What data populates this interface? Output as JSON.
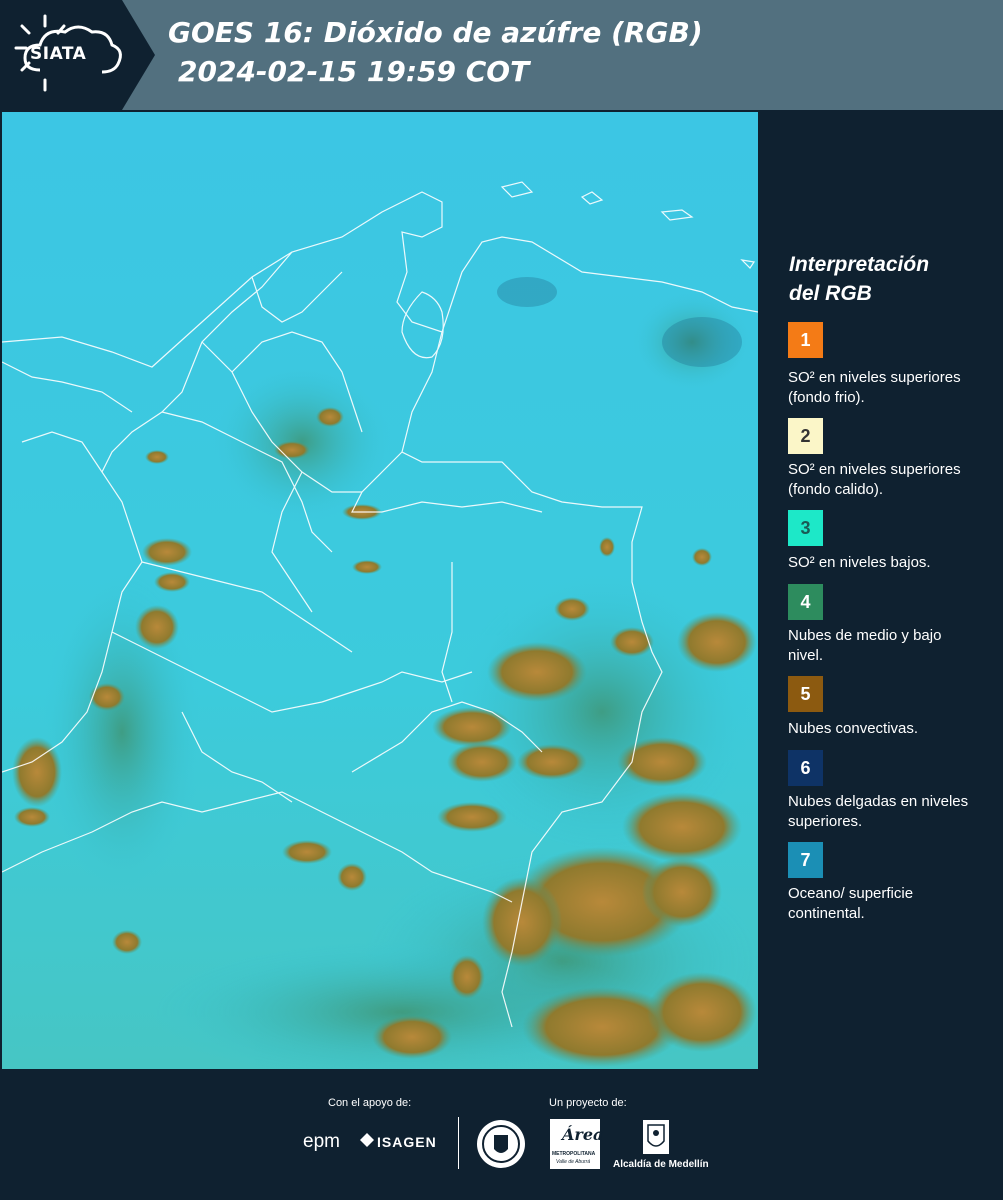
{
  "header": {
    "logo_text": "SIATA",
    "title_line1": "GOES 16: Dióxido de azúfre (RGB)",
    "title_line2": "2024-02-15 19:59 COT"
  },
  "map": {
    "description_icon": "satellite-rgb-map"
  },
  "legend": {
    "title_line1": "Interpretación",
    "title_line2": "del RGB",
    "items": [
      {
        "number": "1",
        "color": "#f47b16",
        "text_color": "#ffffff",
        "description": "SO² en niveles superiores (fondo frio)."
      },
      {
        "number": "2",
        "color": "#fbf6c8",
        "text_color": "#333333",
        "description": "SO² en niveles superiores (fondo calido)."
      },
      {
        "number": "3",
        "color": "#1de8c8",
        "text_color": "#1a5a55",
        "description": "SO² en niveles bajos."
      },
      {
        "number": "4",
        "color": "#2d8c5e",
        "text_color": "#ffffff",
        "description": "Nubes de medio y bajo nivel."
      },
      {
        "number": "5",
        "color": "#8c5a10",
        "text_color": "#ffffff",
        "description": "Nubes convectivas."
      },
      {
        "number": "6",
        "color": "#0e3366",
        "text_color": "#ffffff",
        "description": "Nubes delgadas en niveles superiores."
      },
      {
        "number": "7",
        "color": "#1b8fb5",
        "text_color": "#ffffff",
        "description": "Oceano/ superficie continental."
      }
    ]
  },
  "footer": {
    "support_label": "Con el apoyo de:",
    "project_label": "Un proyecto de:",
    "brand_epm": "epm",
    "brand_isagen": "ISAGEN",
    "brand_area": "Área",
    "brand_area_sub1": "METROPOLITANA",
    "brand_area_sub2": "Valle de Aburrá",
    "brand_alcaldia": "Alcaldía de Medellín"
  },
  "colors": {
    "header_bg": "#52707f",
    "logo_bg": "#0f2130",
    "panel_bg": "#0f2130",
    "map_bg": "#36c6de",
    "cloud_convective": "#9a7a2a",
    "border_lines": "#ffffff"
  }
}
